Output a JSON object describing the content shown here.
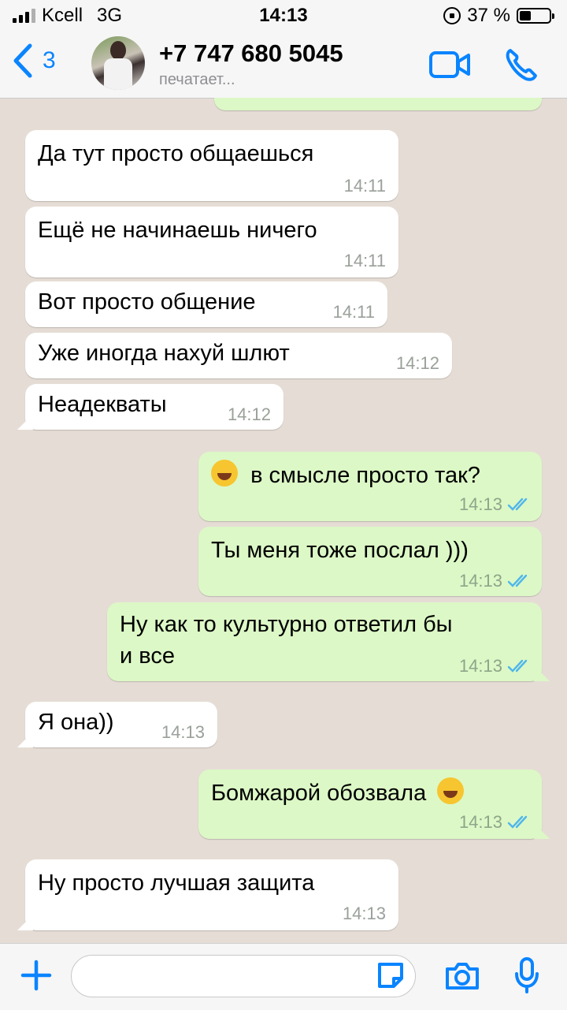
{
  "status_bar": {
    "carrier": "Kcell",
    "network": "3G",
    "time": "14:13",
    "battery": "37 %"
  },
  "header": {
    "back_count": "3",
    "contact": "+7 747 680 5045",
    "status": "печатает..."
  },
  "messages": [
    {
      "dir": "in",
      "text": "Да тут просто общаешься",
      "time": "14:11"
    },
    {
      "dir": "in",
      "text": "Ещё не начинаешь ничего",
      "time": "14:11"
    },
    {
      "dir": "in",
      "text": "Вот просто общение",
      "time": "14:11"
    },
    {
      "dir": "in",
      "text": "Уже иногда нахуй шлют",
      "time": "14:12"
    },
    {
      "dir": "in",
      "text": "Неадекваты",
      "time": "14:12"
    },
    {
      "dir": "out",
      "text": "в смысле просто так?",
      "time": "14:13"
    },
    {
      "dir": "out",
      "text": "Ты меня тоже послал )))",
      "time": "14:13"
    },
    {
      "dir": "out",
      "text_line1": "Ну как то культурно ответил бы",
      "text_line2": "и все",
      "time": "14:13"
    },
    {
      "dir": "in",
      "text": "Я она))",
      "time": "14:13"
    },
    {
      "dir": "out",
      "text": "Бомжарой обозвала",
      "time": "14:13"
    },
    {
      "dir": "in",
      "text": "Ну просто лучшая защита",
      "time": "14:13"
    }
  ],
  "icons": [
    "back-chevron-icon",
    "video-call-icon",
    "phone-icon",
    "plus-icon",
    "sticker-icon",
    "camera-icon",
    "microphone-icon",
    "double-check-icon",
    "rolling-laughing-emoji"
  ],
  "colors": {
    "accent": "#0a84ff",
    "incoming": "#ffffff",
    "outgoing": "#dcf8c6",
    "read_ticks": "#4fb6ec",
    "background": "#e5ddd5"
  }
}
